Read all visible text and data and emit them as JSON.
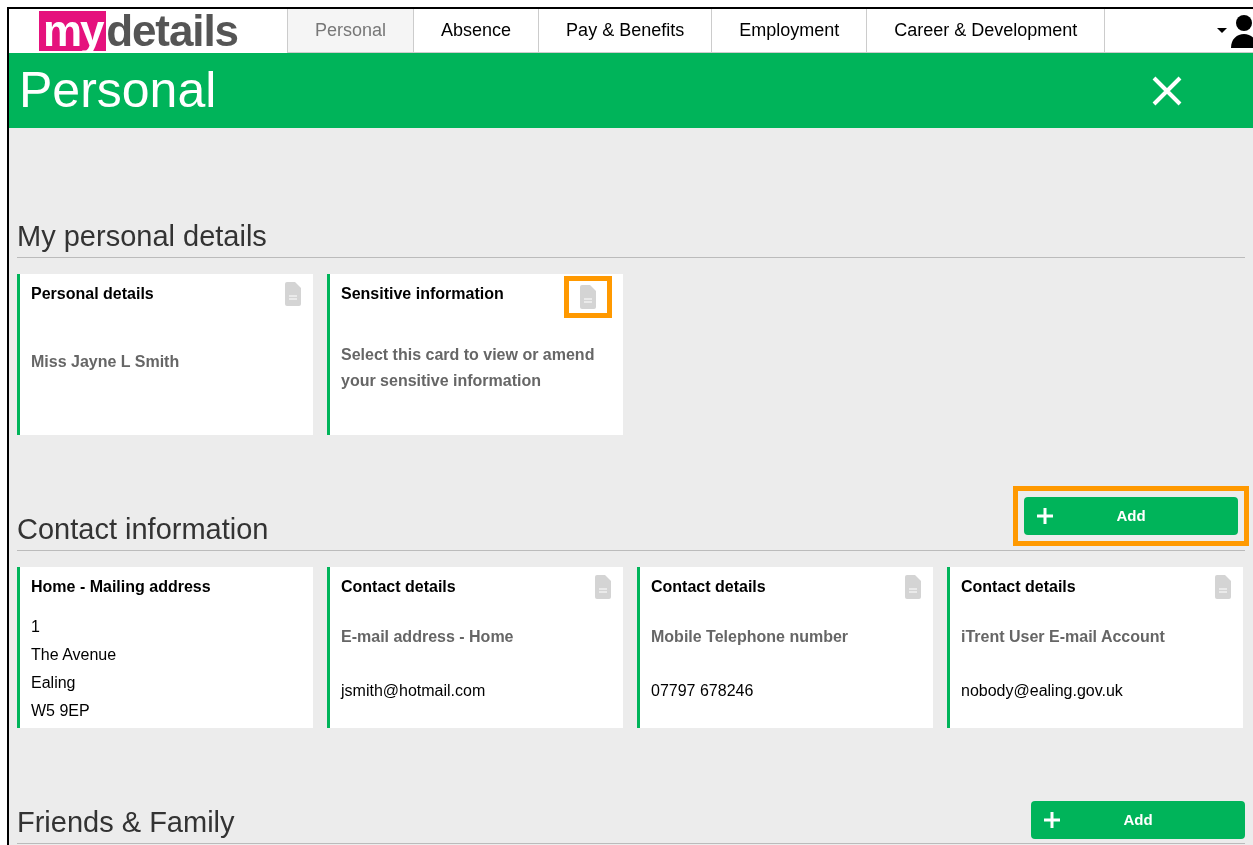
{
  "logo": {
    "part_1": "my",
    "part_2": "details"
  },
  "nav": [
    {
      "label": "Personal",
      "selected": true
    },
    {
      "label": "Absence",
      "selected": false
    },
    {
      "label": "Pay & Benefits",
      "selected": false
    },
    {
      "label": "Employment",
      "selected": false
    },
    {
      "label": "Career & Development",
      "selected": false
    }
  ],
  "page_title": "Personal",
  "sections": [
    {
      "title": "My personal details",
      "cards": [
        {
          "kind": "value",
          "title": "Personal details",
          "document_icon": true,
          "highlighted": false,
          "text": "Miss Jayne L Smith"
        },
        {
          "kind": "value",
          "title": "Sensitive information",
          "document_icon": true,
          "highlighted": true,
          "text": "Select this card to view or amend your sensitive information"
        }
      ]
    },
    {
      "title": "Contact information",
      "add_button": {
        "label": "Add",
        "highlighted": true
      },
      "cards": [
        {
          "kind": "address",
          "title": "Home - Mailing address",
          "document_icon": false,
          "lines": [
            "1",
            "The Avenue",
            "Ealing",
            "W5 9EP"
          ]
        },
        {
          "kind": "contact",
          "title": "Contact details",
          "document_icon": true,
          "highlighted": false,
          "label": "E-mail address - Home",
          "value": "jsmith@hotmail.com"
        },
        {
          "kind": "contact",
          "title": "Contact details",
          "document_icon": true,
          "highlighted": false,
          "label": "Mobile Telephone number",
          "value": "07797 678246"
        },
        {
          "kind": "contact",
          "title": "Contact details",
          "document_icon": true,
          "highlighted": false,
          "label": "iTrent User E-mail Account",
          "value": "nobody@ealing.gov.uk"
        }
      ]
    },
    {
      "title": "Friends & Family",
      "add_button": {
        "label": "Add",
        "highlighted": false
      }
    }
  ]
}
